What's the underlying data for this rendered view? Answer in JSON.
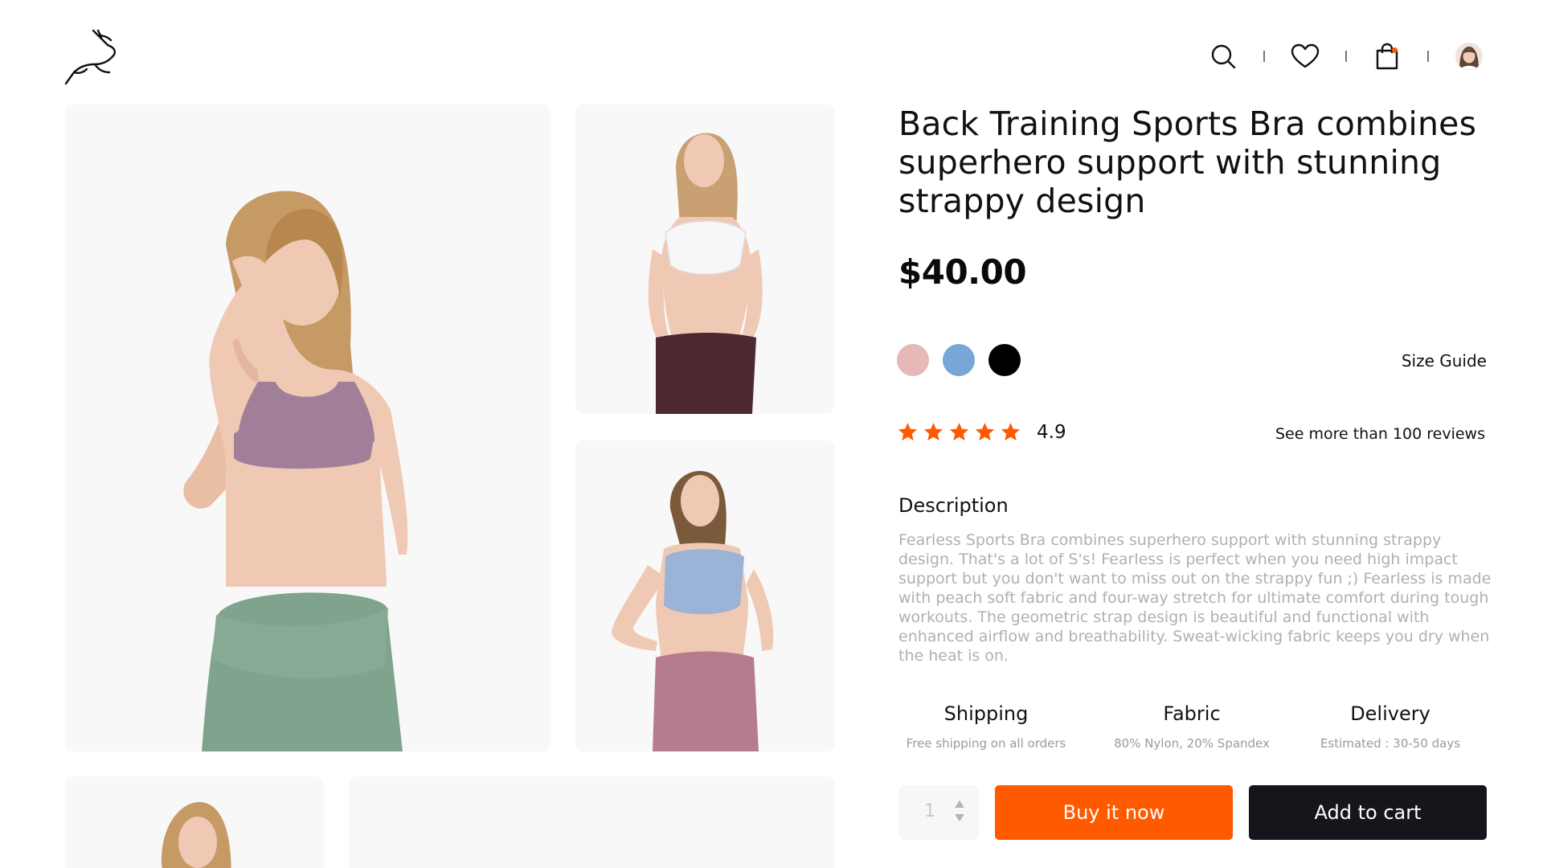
{
  "header": {
    "logo": "gazelle-logo",
    "icons": [
      "search-icon",
      "heart-icon",
      "bag-icon",
      "avatar"
    ],
    "cart_indicator_color": "#ff5a00"
  },
  "gallery": {
    "images": [
      {
        "name": "model-mauve-bra-green-leggings",
        "top_color": "#a27f99",
        "bottom_color": "#7fa38d"
      },
      {
        "name": "model-white-bra-burgundy-leggings",
        "top_color": "#f7f7f7",
        "bottom_color": "#4c2830"
      },
      {
        "name": "model-blue-bra-rose-leggings",
        "top_color": "#9bb3d6",
        "bottom_color": "#b67c8d"
      },
      {
        "name": "model-thumbnail",
        "top_color": "#d9b48a",
        "bottom_color": "#f8f8f8"
      },
      {
        "name": "model-wide",
        "top_color": "#d9b48a",
        "bottom_color": "#f8f8f8"
      }
    ]
  },
  "product": {
    "title": "Back Training Sports Bra combines superhero support with stunning strappy design",
    "price": "$40.00",
    "colors": [
      "#e6b8b8",
      "#78a6d6",
      "#000000"
    ],
    "size_guide_label": "Size Guide",
    "rating": "4.9",
    "stars": 5,
    "star_color": "#ff5a00",
    "reviews_label": "See more than 100 reviews",
    "description_heading": "Description",
    "description": "Fearless Sports Bra combines superhero support with stunning strappy design. That's a lot of S's! Fearless is perfect when you need high impact support but you don't want to miss out on the strappy fun ;) Fearless is made with peach soft fabric and four-way stretch for ultimate comfort during tough workouts. The geometric strap design is beautiful and functional with enhanced airflow and breathability. Sweat-wicking fabric keeps you dry when the heat is on.",
    "features": [
      {
        "title": "Shipping",
        "subtitle": "Free shipping on all orders"
      },
      {
        "title": "Fabric",
        "subtitle": "80% Nylon, 20% Spandex"
      },
      {
        "title": "Delivery",
        "subtitle": "Estimated : 30-50 days"
      }
    ],
    "quantity": "1",
    "buy_label": "Buy it now",
    "cart_label": "Add to cart",
    "buy_color": "#ff5a00",
    "cart_color": "#14161c"
  }
}
